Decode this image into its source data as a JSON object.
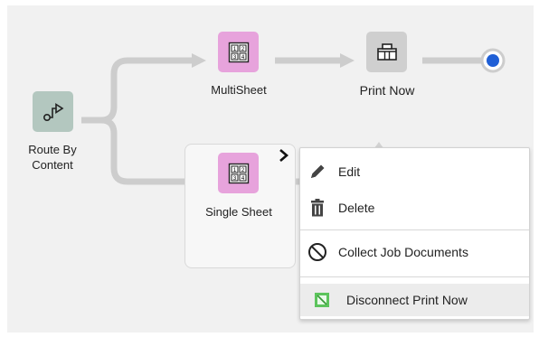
{
  "workflow": {
    "nodes": {
      "route": {
        "label_line1": "Route By",
        "label_line2": "Content",
        "icon": "route-icon"
      },
      "multisheet": {
        "label": "MultiSheet",
        "icon": "multi-page-icon"
      },
      "printnow": {
        "label": "Print Now",
        "icon": "printer-icon"
      },
      "singlesheet": {
        "label": "Single Sheet",
        "icon": "multi-page-icon"
      },
      "endpoint": {
        "icon": "end-dot-icon"
      }
    }
  },
  "context_menu": {
    "items": [
      {
        "label": "Edit",
        "icon": "pencil-icon"
      },
      {
        "label": "Delete",
        "icon": "trash-icon"
      },
      {
        "label": "Collect Job Documents",
        "icon": "prohibit-icon"
      },
      {
        "label": "Disconnect Print Now",
        "icon": "disconnect-icon"
      }
    ]
  },
  "colors": {
    "pink_node": "#e7a3dc",
    "gray_node": "#cfcfcf",
    "route_node": "#b3c7bf",
    "wire": "#cdcdcd",
    "end_dot": "#1f5fd6",
    "disconnect_green": "#5cc45c"
  }
}
